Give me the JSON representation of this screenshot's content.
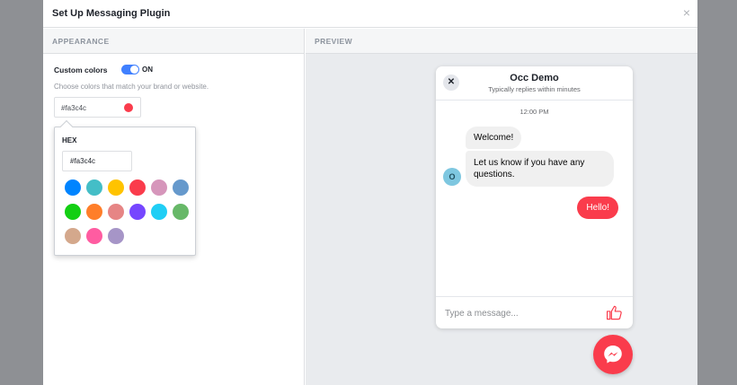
{
  "dialog": {
    "title": "Set Up Messaging Plugin",
    "close_glyph": "×"
  },
  "appearance": {
    "section_label": "APPEARANCE",
    "custom_colors_label": "Custom colors",
    "toggle_state": "ON",
    "helper_text": "Choose colors that match your brand or website.",
    "selected_hex": "#fa3c4c",
    "picker": {
      "hex_label": "HEX",
      "hex_value": "#fa3c4c",
      "swatches": [
        "#0084ff",
        "#44bec7",
        "#ffc300",
        "#fa3c4c",
        "#d696bb",
        "#6699cc",
        "#13cf13",
        "#ff7e29",
        "#e68585",
        "#7646ff",
        "#20cef5",
        "#67b868",
        "#d4a88c",
        "#ff5ca1",
        "#a695c7"
      ]
    }
  },
  "preview": {
    "section_label": "PREVIEW",
    "chat": {
      "close_glyph": "✕",
      "page_name": "Occ Demo",
      "subtitle": "Typically replies within minutes",
      "time": "12:00 PM",
      "messages": [
        "Welcome!",
        "Let us know if you have any questions.",
        "Hello!"
      ],
      "avatar_initial": "O",
      "composer_placeholder": "Type a message...",
      "like_icon": "thumbs-up-icon"
    },
    "launcher_icon": "messenger-icon"
  },
  "colors": {
    "accent": "#fa3c4c",
    "toggle": "#4080ff"
  }
}
